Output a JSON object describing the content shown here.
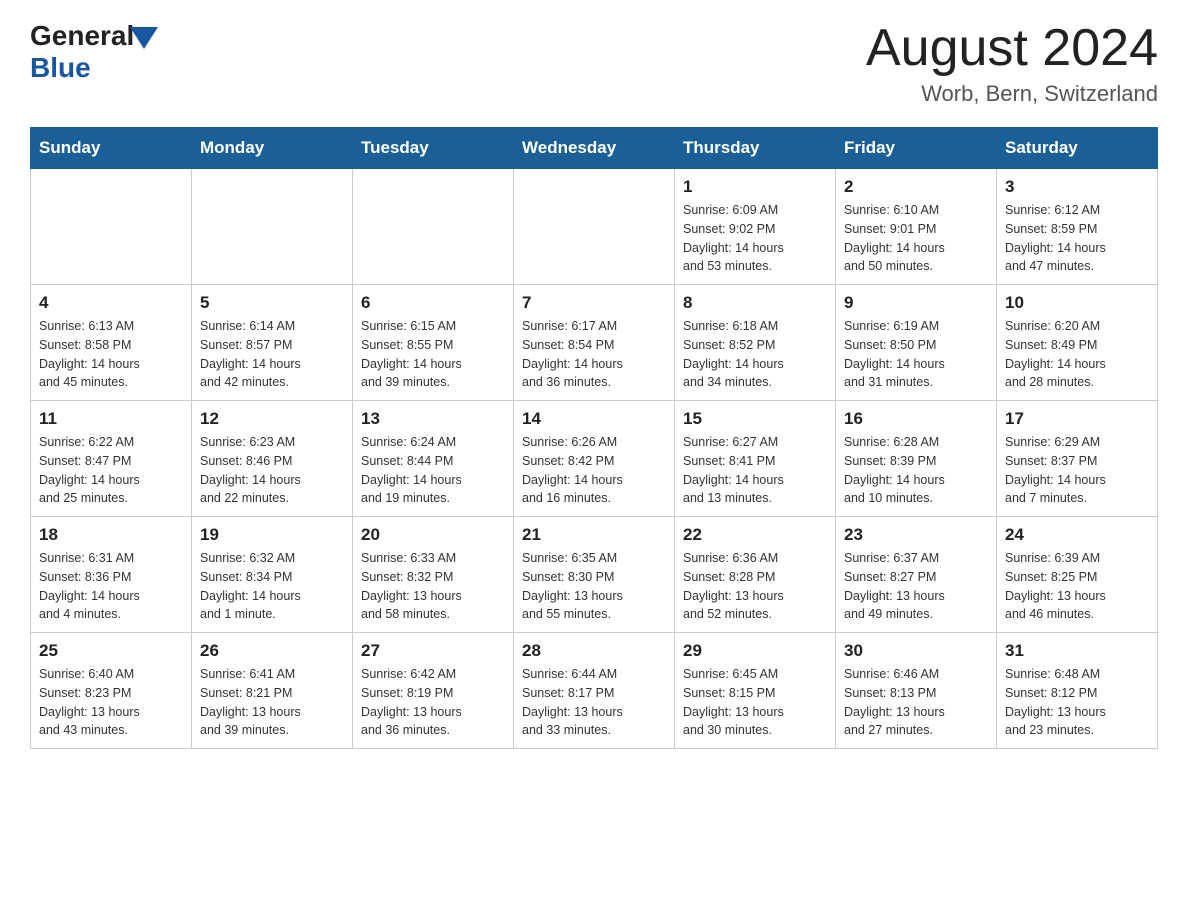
{
  "header": {
    "logo_general": "General",
    "logo_blue": "Blue",
    "month_title": "August 2024",
    "location": "Worb, Bern, Switzerland"
  },
  "weekdays": [
    "Sunday",
    "Monday",
    "Tuesday",
    "Wednesday",
    "Thursday",
    "Friday",
    "Saturday"
  ],
  "weeks": [
    [
      {
        "day": "",
        "info": ""
      },
      {
        "day": "",
        "info": ""
      },
      {
        "day": "",
        "info": ""
      },
      {
        "day": "",
        "info": ""
      },
      {
        "day": "1",
        "info": "Sunrise: 6:09 AM\nSunset: 9:02 PM\nDaylight: 14 hours\nand 53 minutes."
      },
      {
        "day": "2",
        "info": "Sunrise: 6:10 AM\nSunset: 9:01 PM\nDaylight: 14 hours\nand 50 minutes."
      },
      {
        "day": "3",
        "info": "Sunrise: 6:12 AM\nSunset: 8:59 PM\nDaylight: 14 hours\nand 47 minutes."
      }
    ],
    [
      {
        "day": "4",
        "info": "Sunrise: 6:13 AM\nSunset: 8:58 PM\nDaylight: 14 hours\nand 45 minutes."
      },
      {
        "day": "5",
        "info": "Sunrise: 6:14 AM\nSunset: 8:57 PM\nDaylight: 14 hours\nand 42 minutes."
      },
      {
        "day": "6",
        "info": "Sunrise: 6:15 AM\nSunset: 8:55 PM\nDaylight: 14 hours\nand 39 minutes."
      },
      {
        "day": "7",
        "info": "Sunrise: 6:17 AM\nSunset: 8:54 PM\nDaylight: 14 hours\nand 36 minutes."
      },
      {
        "day": "8",
        "info": "Sunrise: 6:18 AM\nSunset: 8:52 PM\nDaylight: 14 hours\nand 34 minutes."
      },
      {
        "day": "9",
        "info": "Sunrise: 6:19 AM\nSunset: 8:50 PM\nDaylight: 14 hours\nand 31 minutes."
      },
      {
        "day": "10",
        "info": "Sunrise: 6:20 AM\nSunset: 8:49 PM\nDaylight: 14 hours\nand 28 minutes."
      }
    ],
    [
      {
        "day": "11",
        "info": "Sunrise: 6:22 AM\nSunset: 8:47 PM\nDaylight: 14 hours\nand 25 minutes."
      },
      {
        "day": "12",
        "info": "Sunrise: 6:23 AM\nSunset: 8:46 PM\nDaylight: 14 hours\nand 22 minutes."
      },
      {
        "day": "13",
        "info": "Sunrise: 6:24 AM\nSunset: 8:44 PM\nDaylight: 14 hours\nand 19 minutes."
      },
      {
        "day": "14",
        "info": "Sunrise: 6:26 AM\nSunset: 8:42 PM\nDaylight: 14 hours\nand 16 minutes."
      },
      {
        "day": "15",
        "info": "Sunrise: 6:27 AM\nSunset: 8:41 PM\nDaylight: 14 hours\nand 13 minutes."
      },
      {
        "day": "16",
        "info": "Sunrise: 6:28 AM\nSunset: 8:39 PM\nDaylight: 14 hours\nand 10 minutes."
      },
      {
        "day": "17",
        "info": "Sunrise: 6:29 AM\nSunset: 8:37 PM\nDaylight: 14 hours\nand 7 minutes."
      }
    ],
    [
      {
        "day": "18",
        "info": "Sunrise: 6:31 AM\nSunset: 8:36 PM\nDaylight: 14 hours\nand 4 minutes."
      },
      {
        "day": "19",
        "info": "Sunrise: 6:32 AM\nSunset: 8:34 PM\nDaylight: 14 hours\nand 1 minute."
      },
      {
        "day": "20",
        "info": "Sunrise: 6:33 AM\nSunset: 8:32 PM\nDaylight: 13 hours\nand 58 minutes."
      },
      {
        "day": "21",
        "info": "Sunrise: 6:35 AM\nSunset: 8:30 PM\nDaylight: 13 hours\nand 55 minutes."
      },
      {
        "day": "22",
        "info": "Sunrise: 6:36 AM\nSunset: 8:28 PM\nDaylight: 13 hours\nand 52 minutes."
      },
      {
        "day": "23",
        "info": "Sunrise: 6:37 AM\nSunset: 8:27 PM\nDaylight: 13 hours\nand 49 minutes."
      },
      {
        "day": "24",
        "info": "Sunrise: 6:39 AM\nSunset: 8:25 PM\nDaylight: 13 hours\nand 46 minutes."
      }
    ],
    [
      {
        "day": "25",
        "info": "Sunrise: 6:40 AM\nSunset: 8:23 PM\nDaylight: 13 hours\nand 43 minutes."
      },
      {
        "day": "26",
        "info": "Sunrise: 6:41 AM\nSunset: 8:21 PM\nDaylight: 13 hours\nand 39 minutes."
      },
      {
        "day": "27",
        "info": "Sunrise: 6:42 AM\nSunset: 8:19 PM\nDaylight: 13 hours\nand 36 minutes."
      },
      {
        "day": "28",
        "info": "Sunrise: 6:44 AM\nSunset: 8:17 PM\nDaylight: 13 hours\nand 33 minutes."
      },
      {
        "day": "29",
        "info": "Sunrise: 6:45 AM\nSunset: 8:15 PM\nDaylight: 13 hours\nand 30 minutes."
      },
      {
        "day": "30",
        "info": "Sunrise: 6:46 AM\nSunset: 8:13 PM\nDaylight: 13 hours\nand 27 minutes."
      },
      {
        "day": "31",
        "info": "Sunrise: 6:48 AM\nSunset: 8:12 PM\nDaylight: 13 hours\nand 23 minutes."
      }
    ]
  ]
}
